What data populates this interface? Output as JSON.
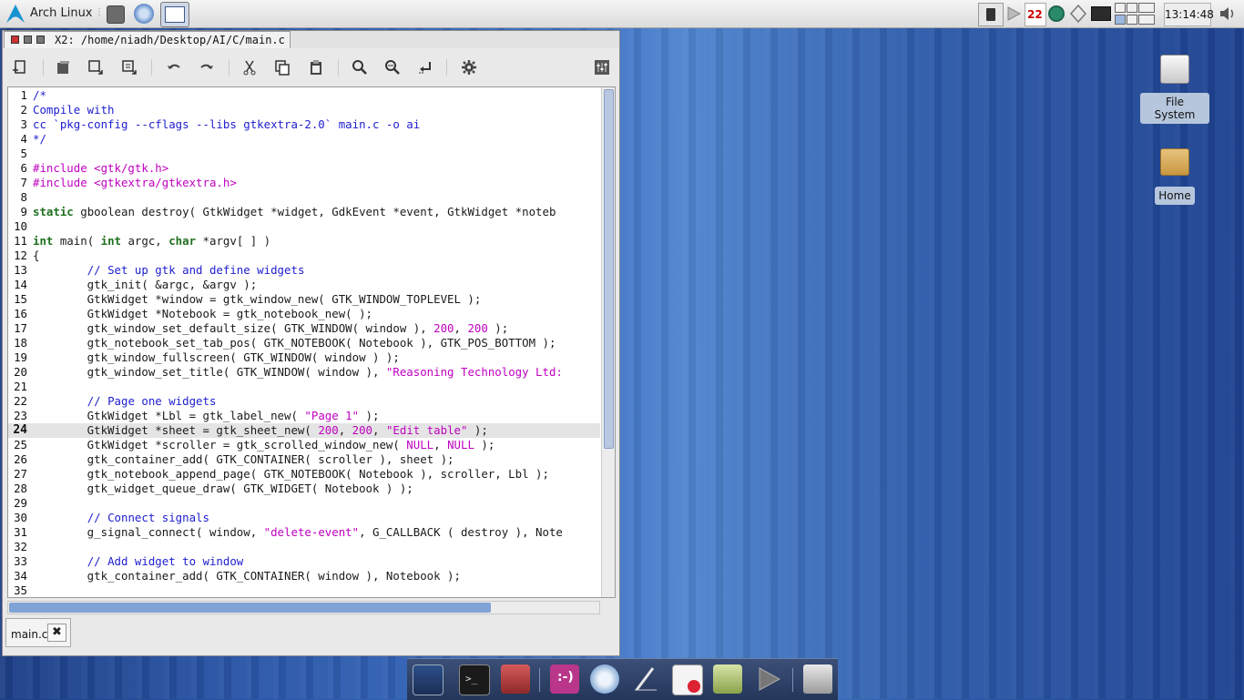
{
  "panel": {
    "distro_label": "Arch Linux",
    "clock": "13:14:48",
    "calendar_day": "22",
    "launchers": [
      "terminal-launcher",
      "web-browser-launcher",
      "window-list-button"
    ],
    "tray_icons": [
      "clipboard-icon",
      "media-play-icon",
      "calendar-icon",
      "network-icon",
      "updates-icon",
      "monitor-icon"
    ],
    "volume_icon": "volume-icon"
  },
  "window": {
    "title": "X2: /home/niadh/Desktop/AI/C/main.c",
    "toolbar": [
      "new-document-icon",
      "copy-document-icon",
      "save-icon",
      "save-as-icon",
      "undo-icon",
      "redo-icon",
      "cut-icon",
      "copy-icon",
      "paste-icon",
      "find-icon",
      "find-replace-icon",
      "goto-line-icon",
      "settings-icon",
      "options-icon"
    ],
    "current_line": 24,
    "tab_label": "main.c",
    "tab_close": "✖"
  },
  "code": [
    {
      "n": "1",
      "segs": [
        [
          "com",
          "/*"
        ]
      ]
    },
    {
      "n": "2",
      "segs": [
        [
          "com",
          "Compile with"
        ]
      ]
    },
    {
      "n": "3",
      "segs": [
        [
          "com",
          "cc `pkg-config --cflags --libs gtkextra-2.0` main.c -o ai"
        ]
      ]
    },
    {
      "n": "4",
      "segs": [
        [
          "com",
          "*/"
        ]
      ]
    },
    {
      "n": "5",
      "segs": []
    },
    {
      "n": "6",
      "segs": [
        [
          "pre",
          "#include <gtk/gtk.h>"
        ]
      ]
    },
    {
      "n": "7",
      "segs": [
        [
          "pre",
          "#include <gtkextra/gtkextra.h>"
        ]
      ]
    },
    {
      "n": "8",
      "segs": []
    },
    {
      "n": "9",
      "segs": [
        [
          "kw",
          "static"
        ],
        [
          "",
          "gboolean destroy( GtkWidget *widget, GdkEvent *event, GtkWidget *noteb"
        ]
      ]
    },
    {
      "n": "10",
      "segs": []
    },
    {
      "n": "11",
      "segs": [
        [
          "kw",
          "int"
        ],
        [
          "",
          " main( "
        ],
        [
          "kw",
          "int"
        ],
        [
          "",
          " argc, "
        ],
        [
          "kw",
          "char"
        ],
        [
          "",
          " *argv[ ] )"
        ]
      ]
    },
    {
      "n": "12",
      "segs": [
        [
          "",
          "{"
        ]
      ]
    },
    {
      "n": "13",
      "segs": [
        [
          "",
          "        "
        ],
        [
          "com",
          "// Set up gtk and define widgets"
        ]
      ]
    },
    {
      "n": "14",
      "segs": [
        [
          "",
          "        gtk_init( &argc, &argv );"
        ]
      ]
    },
    {
      "n": "15",
      "segs": [
        [
          "",
          "        GtkWidget *window = gtk_window_new( GTK_WINDOW_TOPLEVEL );"
        ]
      ]
    },
    {
      "n": "16",
      "segs": [
        [
          "",
          "        GtkWidget *Notebook = gtk_notebook_new( );"
        ]
      ]
    },
    {
      "n": "17",
      "segs": [
        [
          "",
          "        gtk_window_set_default_size( GTK_WINDOW( window ), "
        ],
        [
          "num",
          "200"
        ],
        [
          "",
          ", "
        ],
        [
          "num",
          "200"
        ],
        [
          "",
          " );"
        ]
      ]
    },
    {
      "n": "18",
      "segs": [
        [
          "",
          "        gtk_notebook_set_tab_pos( GTK_NOTEBOOK( Notebook ), GTK_POS_BOTTOM );"
        ]
      ]
    },
    {
      "n": "19",
      "segs": [
        [
          "",
          "        gtk_window_fullscreen( GTK_WINDOW( window ) );"
        ]
      ]
    },
    {
      "n": "20",
      "segs": [
        [
          "",
          "        gtk_window_set_title( GTK_WINDOW( window ), "
        ],
        [
          "str",
          "\"Reasoning Technology Ltd:"
        ]
      ]
    },
    {
      "n": "21",
      "segs": []
    },
    {
      "n": "22",
      "segs": [
        [
          "",
          "        "
        ],
        [
          "com",
          "// Page one widgets"
        ]
      ]
    },
    {
      "n": "23",
      "segs": [
        [
          "",
          "        GtkWidget *Lbl = gtk_label_new( "
        ],
        [
          "str",
          "\"Page 1\""
        ],
        [
          "",
          " );"
        ]
      ]
    },
    {
      "n": "24",
      "segs": [
        [
          "",
          "        GtkWidget *sheet = gtk_sheet_new( "
        ],
        [
          "num",
          "200"
        ],
        [
          "",
          ", "
        ],
        [
          "num",
          "200"
        ],
        [
          "",
          ", "
        ],
        [
          "str",
          "\"Edit table\""
        ],
        [
          "",
          " );"
        ]
      ]
    },
    {
      "n": "25",
      "segs": [
        [
          "",
          "        GtkWidget *scroller = gtk_scrolled_window_new( "
        ],
        [
          "num",
          "NULL"
        ],
        [
          "",
          ", "
        ],
        [
          "num",
          "NULL"
        ],
        [
          "",
          " );"
        ]
      ]
    },
    {
      "n": "26",
      "segs": [
        [
          "",
          "        gtk_container_add( GTK_CONTAINER( scroller ), sheet );"
        ]
      ]
    },
    {
      "n": "27",
      "segs": [
        [
          "",
          "        gtk_notebook_append_page( GTK_NOTEBOOK( Notebook ), scroller, Lbl );"
        ]
      ]
    },
    {
      "n": "28",
      "segs": [
        [
          "",
          "        gtk_widget_queue_draw( GTK_WIDGET( Notebook ) );"
        ]
      ]
    },
    {
      "n": "29",
      "segs": []
    },
    {
      "n": "30",
      "segs": [
        [
          "",
          "        "
        ],
        [
          "com",
          "// Connect signals"
        ]
      ]
    },
    {
      "n": "31",
      "segs": [
        [
          "",
          "        g_signal_connect( window, "
        ],
        [
          "str",
          "\"delete-event\""
        ],
        [
          "",
          ", G_CALLBACK ( destroy ), Note"
        ]
      ]
    },
    {
      "n": "32",
      "segs": []
    },
    {
      "n": "33",
      "segs": [
        [
          "",
          "        "
        ],
        [
          "com",
          "// Add widget to window"
        ]
      ]
    },
    {
      "n": "34",
      "segs": [
        [
          "",
          "        gtk_container_add( GTK_CONTAINER( window ), Notebook );"
        ]
      ]
    },
    {
      "n": "35",
      "segs": []
    }
  ],
  "desktop": {
    "icons": [
      {
        "label": "File System",
        "icon": "drive-icon"
      },
      {
        "label": "Home",
        "icon": "home-folder-icon"
      }
    ]
  },
  "dock": {
    "items": [
      "system-settings-icon",
      "terminal-icon",
      "system-monitor-icon",
      "chat-icon",
      "browser-icon",
      "text-editor-icon",
      "spreadsheet-icon",
      "finance-icon",
      "media-player-icon",
      "trash-icon"
    ]
  }
}
